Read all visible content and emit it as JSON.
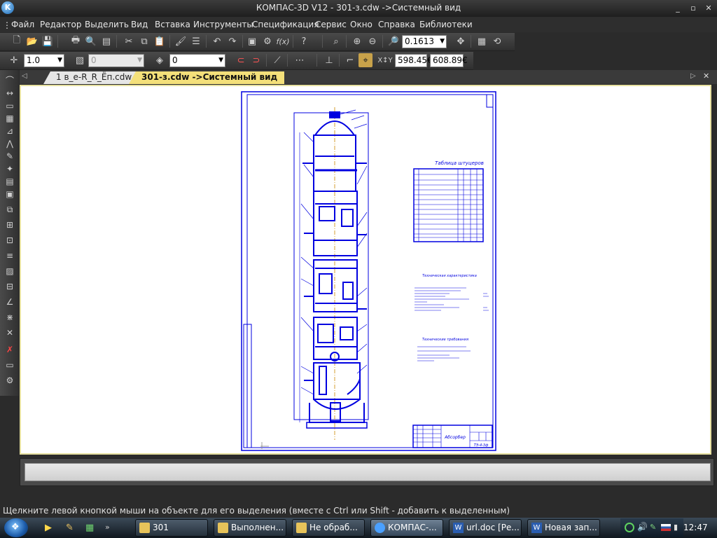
{
  "window": {
    "title": "КОМПАС-3D V12 - 301-з.cdw ->Системный вид",
    "minimize": "_",
    "restore": "▫",
    "close": "✕"
  },
  "menu": [
    "Файл",
    "Редактор",
    "Выделить",
    "Вид",
    "Вставка",
    "Инструменты",
    "Спецификация",
    "Сервис",
    "Окно",
    "Справка",
    "Библиотеки"
  ],
  "toolbar1": {
    "zoom_value": "0.1613"
  },
  "toolbar2": {
    "style_combo": "1.0",
    "layer_combo_disabled": "0",
    "layer_combo": "0",
    "coord_x": "598.45€",
    "coord_y": "608.89€"
  },
  "tabs": [
    {
      "label": "1 в_е-R_R_Ёп.cdw",
      "active": false
    },
    {
      "label": "301-з.cdw ->Системный вид",
      "active": true
    }
  ],
  "tab_controls": {
    "next": "▷",
    "close": "✕",
    "prev": "◁"
  },
  "drawing": {
    "table_title": "Таблица штуцеров",
    "tech_title_1": "Техническая характеристика",
    "tech_title_2": "Технические требования",
    "stamp_name": "Абсорбер",
    "stamp_code": "ТЭ-4-3ф"
  },
  "status": {
    "hint": "Щелкните левой кнопкой мыши на объекте для его выделения (вместе с Ctrl или Shift - добавить к выделенным)"
  },
  "taskbar": {
    "items": [
      {
        "label": "301",
        "icon": "folder-icon"
      },
      {
        "label": "Выполнен...",
        "icon": "folder-icon"
      },
      {
        "label": "Не обраб...",
        "icon": "folder-icon"
      },
      {
        "label": "КОМПАС-...",
        "icon": "kompas-icon",
        "active": true
      },
      {
        "label": "url.doc [Ре...",
        "icon": "word-icon"
      },
      {
        "label": "Новая зап...",
        "icon": "word-icon"
      }
    ],
    "clock": "12:47"
  },
  "colors": {
    "drawing_blue": "#0000e0",
    "canvas_border": "#e6e0a0",
    "active_tab": "#f4e07a"
  }
}
